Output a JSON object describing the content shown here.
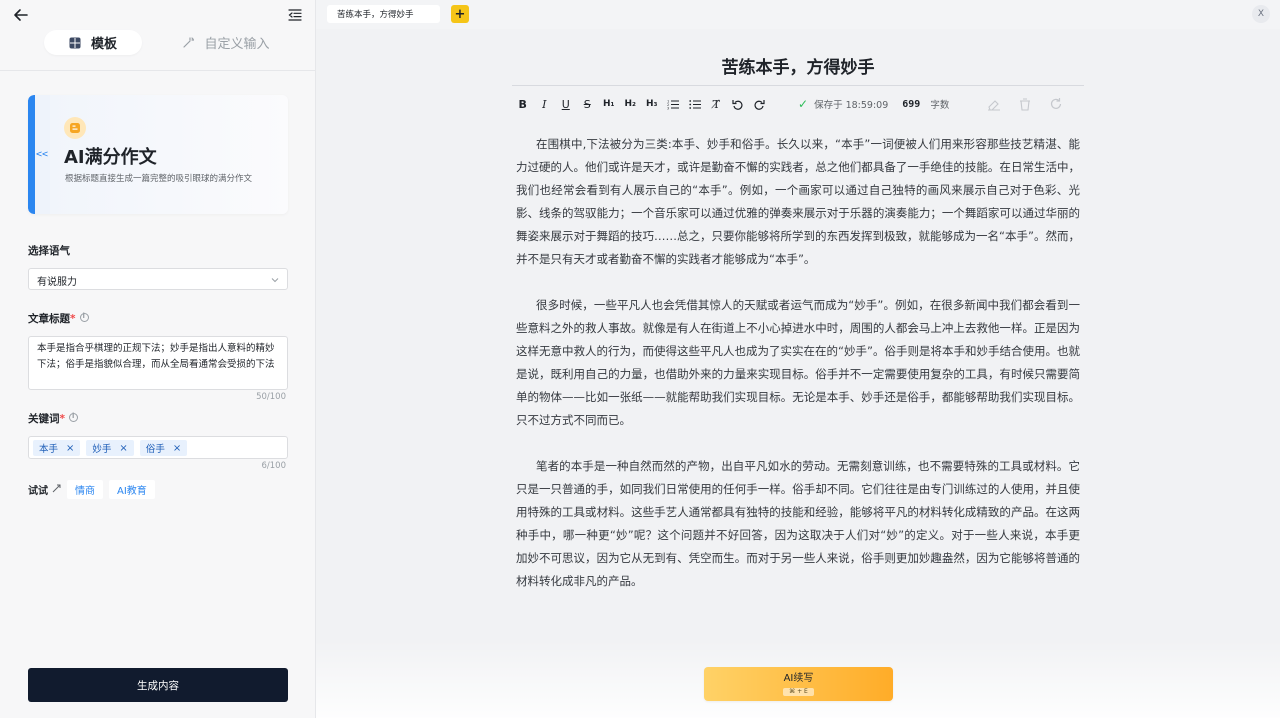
{
  "sidebar": {
    "tabs": [
      {
        "label": "模板",
        "icon": "grid-icon",
        "active": true
      },
      {
        "label": "自定义输入",
        "icon": "magic-wand-icon",
        "active": false
      }
    ],
    "template_card": {
      "collapse_label": "<<",
      "title": "AI满分作文",
      "description": "根据标题直接生成一篇完整的吸引眼球的满分作文",
      "badge_icon": "blog-icon",
      "accent_color": "#2b86f0"
    },
    "tone": {
      "label": "选择语气",
      "value": "有说服力"
    },
    "article_title": {
      "label": "文章标题",
      "required_mark": "*",
      "value": "本手是指合乎棋理的正规下法；妙手是指出人意料的精妙下法；俗手是指貌似合理，而从全局看通常会受损的下法",
      "counter": "50/100"
    },
    "keywords": {
      "label": "关键词",
      "required_mark": "*",
      "tags": [
        "本手",
        "妙手",
        "俗手"
      ],
      "remove_symbol": "×",
      "counter": "6/100"
    },
    "try": {
      "label": "试试",
      "chips": [
        "情商",
        "AI教育"
      ]
    },
    "generate_button": "生成内容"
  },
  "topbar": {
    "doc_tab_label": "苦练本手，方得妙手",
    "add_label": "+",
    "close_label": "X"
  },
  "editor": {
    "title": "苦练本手，方得妙手",
    "save_status": "保存于 18:59:09",
    "word_count": "699",
    "word_count_unit": "字数",
    "paragraphs": [
      "在围棋中,下法被分为三类:本手、妙手和俗手。长久以来，“本手”一词便被人们用来形容那些技艺精湛、能力过硬的人。他们或许是天才，或许是勤奋不懈的实践者，总之他们都具备了一手绝佳的技能。在日常生活中，我们也经常会看到有人展示自己的“本手”。例如，一个画家可以通过自己独特的画风来展示自己对于色彩、光影、线条的驾驭能力；一个音乐家可以通过优雅的弹奏来展示对于乐器的演奏能力；一个舞蹈家可以通过华丽的舞姿来展示对于舞蹈的技巧……总之，只要你能够将所学到的东西发挥到极致，就能够成为一名“本手”。然而，并不是只有天才或者勤奋不懈的实践者才能够成为“本手”。",
      "很多时候，一些平凡人也会凭借其惊人的天赋或者运气而成为“妙手”。例如，在很多新闻中我们都会看到一些意料之外的救人事故。就像是有人在街道上不小心掉进水中时，周围的人都会马上冲上去救他一样。正是因为这样无意中救人的行为，而使得这些平凡人也成为了实实在在的“妙手”。俗手则是将本手和妙手结合使用。也就是说，既利用自己的力量，也借助外来的力量来实现目标。俗手并不一定需要使用复杂的工具，有时候只需要简单的物体——比如一张纸——就能帮助我们实现目标。无论是本手、妙手还是俗手，都能够帮助我们实现目标。只不过方式不同而已。",
      "笔者的本手是一种自然而然的产物，出自平凡如水的劳动。无需刻意训练，也不需要特殊的工具或材料。它只是一只普通的手，如同我们日常使用的任何手一样。俗手却不同。它们往往是由专门训练过的人使用，并且使用特殊的工具或材料。这些手艺人通常都具有独特的技能和经验，能够将平凡的材料转化成精致的产品。在这两种手中，哪一种更“妙”呢？这个问题并不好回答，因为这取决于人们对“妙”的定义。对于一些人来说，本手更加妙不可思议，因为它从无到有、凭空而生。而对于另一些人来说，俗手则更加妙趣盎然，因为它能够将普通的材料转化成非凡的产品。"
    ],
    "ai_button": {
      "label": "AI续写",
      "shortcut": "⌘ + E"
    }
  },
  "colors": {
    "primary_dark": "#111b2e",
    "accent_blue": "#2b86f0",
    "ai_button_from": "#ffd267",
    "ai_button_to": "#ffac28",
    "add_tab": "#f5c518",
    "save_check": "#2ebd59"
  }
}
